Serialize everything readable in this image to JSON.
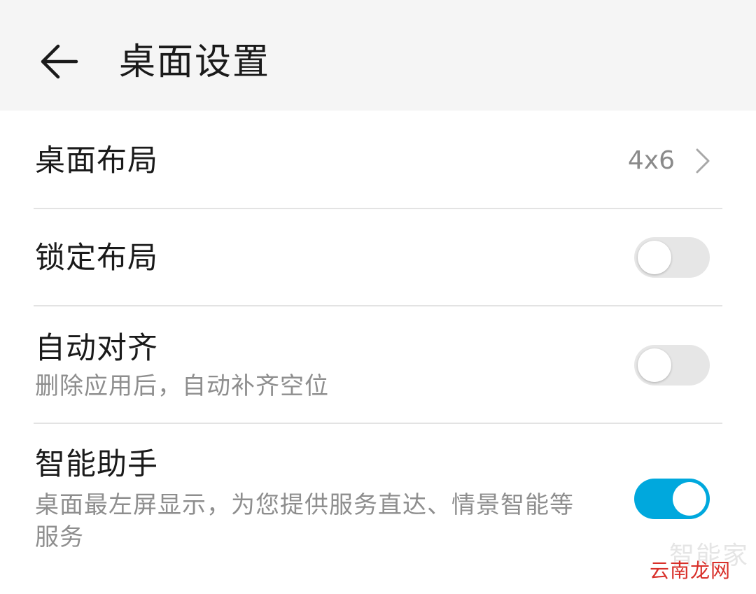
{
  "header": {
    "back_icon": "arrow-left-icon",
    "title": "桌面设置"
  },
  "settings": [
    {
      "title": "桌面布局",
      "value": "4x6",
      "icon": "chevron-right-icon"
    },
    {
      "title": "锁定布局",
      "toggle": false
    },
    {
      "title": "自动对齐",
      "subtitle": "删除应用后，自动补齐空位",
      "toggle": false
    },
    {
      "title": "智能助手",
      "subtitle": "桌面最左屏显示，为您提供服务直达、情景智能等服务",
      "toggle": true
    }
  ],
  "colors": {
    "accent": "#00a8dd",
    "toggle_off": "#e6e6e6",
    "app_bar": "#f5f5f5"
  },
  "watermark": {
    "faint": "智能家",
    "text": "云南龙网"
  }
}
